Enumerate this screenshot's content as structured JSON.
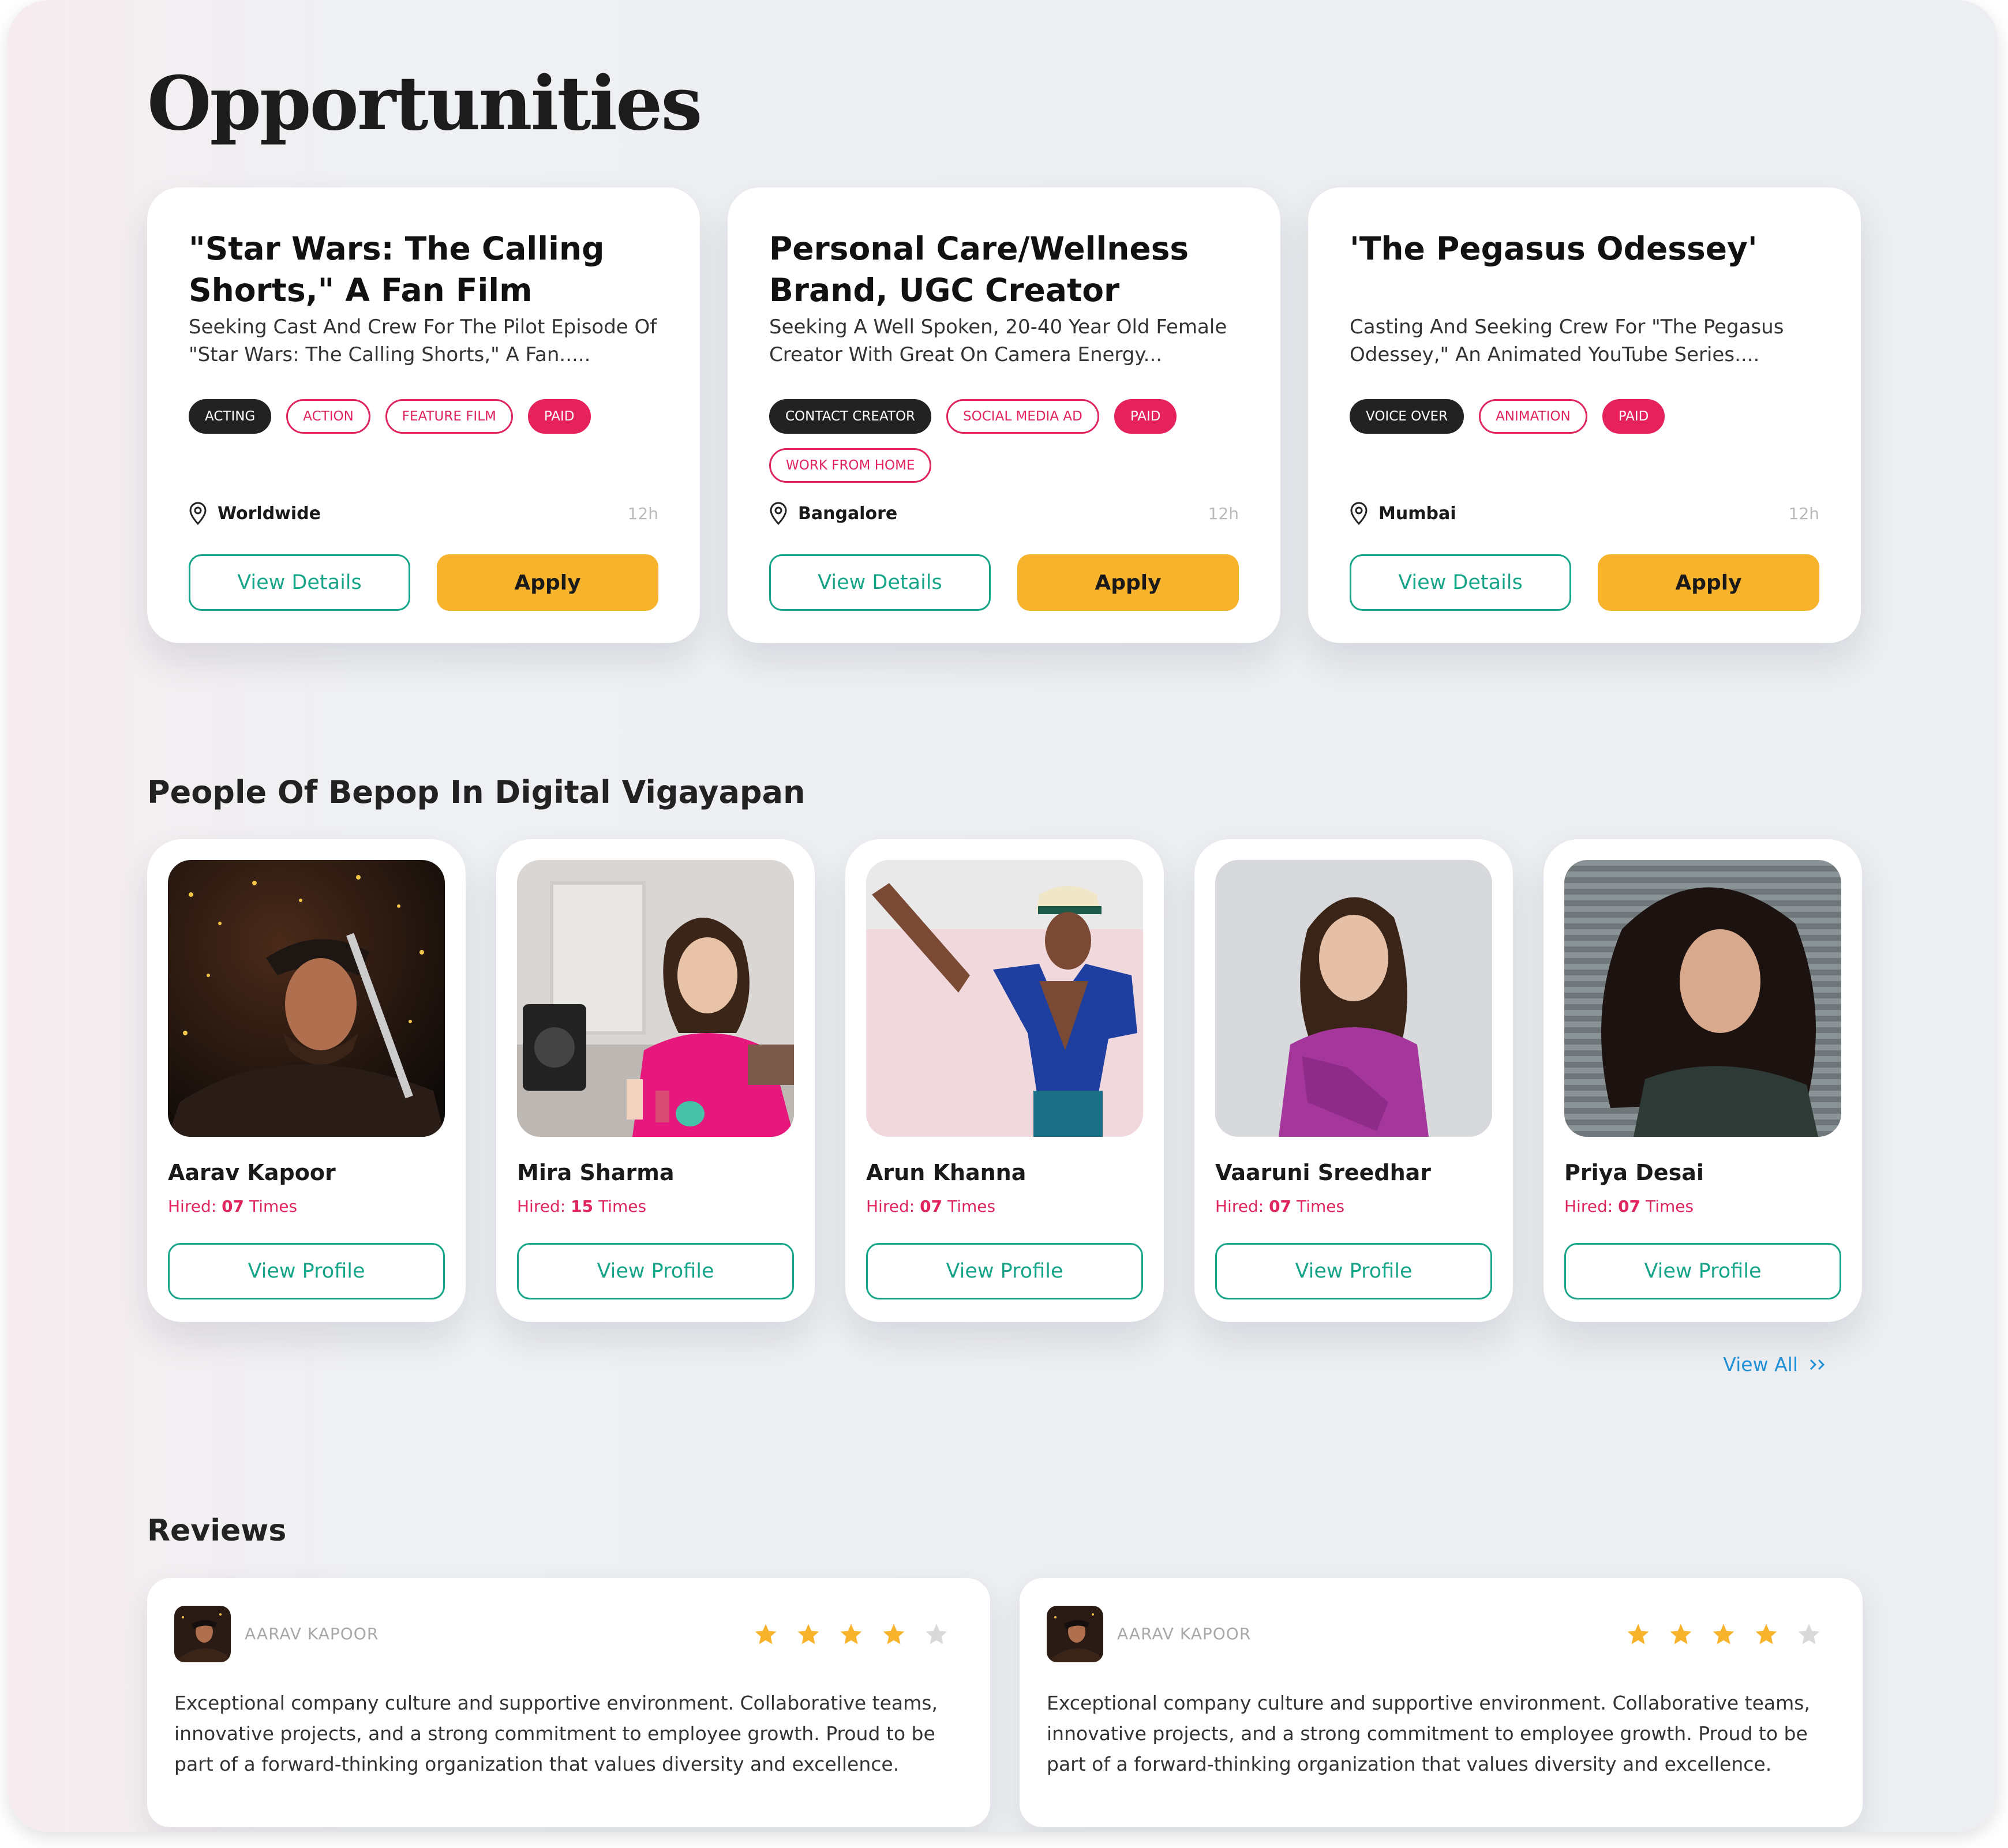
{
  "page": {
    "title": "Opportunities"
  },
  "opportunities": [
    {
      "title": "\"Star Wars: The Calling Shorts,\" A Fan Film",
      "description": "Seeking Cast And Crew For The Pilot Episode Of \"Star Wars: The Calling Shorts,\" A Fan.....",
      "tags": [
        {
          "label": "ACTING",
          "style": "dark"
        },
        {
          "label": "ACTION",
          "style": "outline"
        },
        {
          "label": "FEATURE FILM",
          "style": "outline"
        },
        {
          "label": "PAID",
          "style": "pink"
        }
      ],
      "location": "Worldwide",
      "age": "12h",
      "view_label": "View Details",
      "apply_label": "Apply"
    },
    {
      "title": "Personal Care/Wellness Brand, UGC Creator",
      "description": "Seeking A Well Spoken, 20-40 Year Old Female Creator With Great On Camera Energy...",
      "tags": [
        {
          "label": "CONTACT CREATOR",
          "style": "dark"
        },
        {
          "label": "SOCIAL MEDIA AD",
          "style": "outline"
        },
        {
          "label": "PAID",
          "style": "pink"
        },
        {
          "label": "WORK FROM HOME",
          "style": "outline"
        }
      ],
      "location": "Bangalore",
      "age": "12h",
      "view_label": "View Details",
      "apply_label": "Apply"
    },
    {
      "title": "'The Pegasus Odessey'",
      "description": "Casting And Seeking Crew For \"The Pegasus Odessey,\" An Animated YouTube Series....",
      "tags": [
        {
          "label": "VOICE OVER",
          "style": "dark"
        },
        {
          "label": "ANIMATION",
          "style": "outline"
        },
        {
          "label": "PAID",
          "style": "pink"
        }
      ],
      "location": "Mumbai",
      "age": "12h",
      "view_label": "View Details",
      "apply_label": "Apply"
    }
  ],
  "people_section": {
    "title": "People Of Bepop In Digital Vigayapan",
    "hired_prefix": "Hired: ",
    "hired_suffix": " Times",
    "profile_label": "View Profile",
    "view_all_label": "View All",
    "view_all_icon": "double-chevron-right-icon",
    "people": [
      {
        "name": "Aarav Kapoor",
        "hired": "07"
      },
      {
        "name": "Mira Sharma",
        "hired": "15"
      },
      {
        "name": "Arun Khanna",
        "hired": "07"
      },
      {
        "name": "Vaaruni Sreedhar",
        "hired": "07"
      },
      {
        "name": "Priya Desai",
        "hired": "07"
      }
    ]
  },
  "reviews_section": {
    "title": "Reviews",
    "reviews": [
      {
        "author": "AARAV KAPOOR",
        "rating": 4,
        "max_rating": 5,
        "text": "Exceptional company culture and supportive environment. Collaborative teams, innovative projects, and a strong commitment to employee growth. Proud to be part of a forward-thinking organization that values diversity and excellence."
      },
      {
        "author": "AARAV KAPOOR",
        "rating": 4,
        "max_rating": 5,
        "text": "Exceptional company culture and supportive environment. Collaborative teams, innovative projects, and a strong commitment to employee growth. Proud to be part of a forward-thinking organization that values diversity and excellence."
      }
    ]
  },
  "colors": {
    "accent_teal": "#17a589",
    "apply_yellow": "#f6b32b",
    "tag_pink": "#e5225c",
    "star_gold": "#f6b32b",
    "star_empty": "#d9d9d9",
    "link_blue": "#1f8fd6"
  }
}
